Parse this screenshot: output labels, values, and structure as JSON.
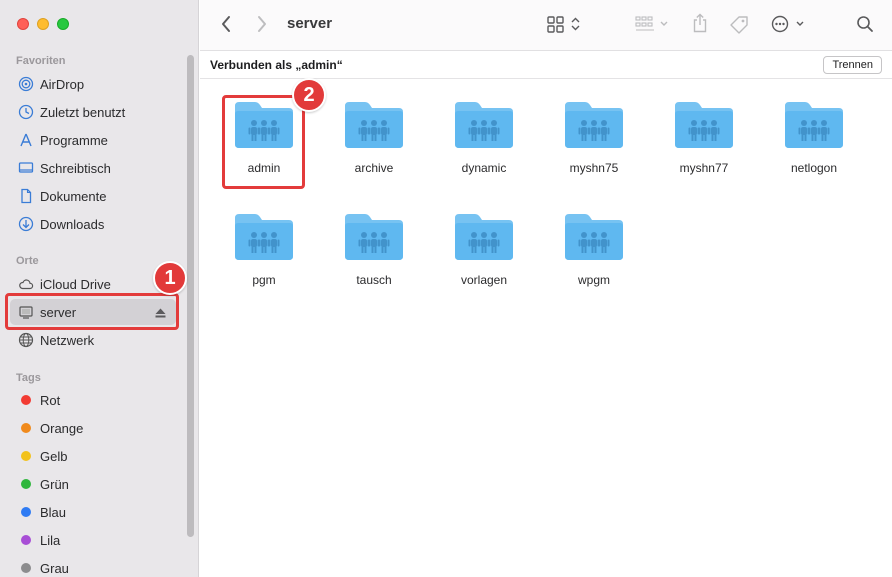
{
  "window": {
    "title": "server"
  },
  "sidebar": {
    "favorites_header": "Favoriten",
    "favorites": [
      {
        "label": "AirDrop",
        "icon": "airdrop-icon"
      },
      {
        "label": "Zuletzt benutzt",
        "icon": "clock-icon"
      },
      {
        "label": "Programme",
        "icon": "apps-icon"
      },
      {
        "label": "Schreibtisch",
        "icon": "desktop-icon"
      },
      {
        "label": "Dokumente",
        "icon": "document-icon"
      },
      {
        "label": "Downloads",
        "icon": "download-icon"
      }
    ],
    "locations_header": "Orte",
    "locations": [
      {
        "label": "iCloud Drive",
        "icon": "cloud-icon"
      },
      {
        "label": "server",
        "icon": "server-icon",
        "selected": true
      },
      {
        "label": "Netzwerk",
        "icon": "network-icon"
      }
    ],
    "tags_header": "Tags",
    "tags": [
      {
        "label": "Rot",
        "color": "#f23b33"
      },
      {
        "label": "Orange",
        "color": "#f08a1c"
      },
      {
        "label": "Gelb",
        "color": "#f2c21c"
      },
      {
        "label": "Grün",
        "color": "#2fb63d"
      },
      {
        "label": "Blau",
        "color": "#2f7bf3"
      },
      {
        "label": "Lila",
        "color": "#a84ed6"
      },
      {
        "label": "Grau",
        "color": "#8c8c8e"
      }
    ]
  },
  "connection": {
    "text": "Verbunden als „admin“",
    "disconnect_label": "Trennen"
  },
  "folders": [
    {
      "name": "admin"
    },
    {
      "name": "archive"
    },
    {
      "name": "dynamic"
    },
    {
      "name": "myshn75"
    },
    {
      "name": "myshn77"
    },
    {
      "name": "netlogon"
    },
    {
      "name": "pgm"
    },
    {
      "name": "tausch"
    },
    {
      "name": "vorlagen"
    },
    {
      "name": "wpgm"
    }
  ],
  "annotations": {
    "step1": "1",
    "step2": "2"
  },
  "colors": {
    "folder": "#5fb8f0",
    "highlight": "#e33b3b"
  }
}
